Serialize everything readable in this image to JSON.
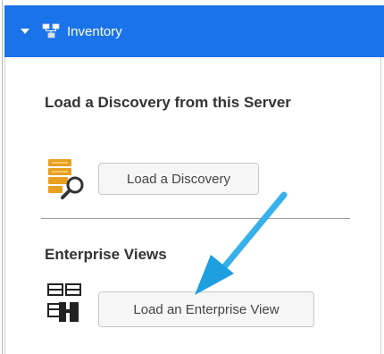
{
  "panel": {
    "title": "Inventory"
  },
  "discovery_section": {
    "title": "Load a Discovery from this Server",
    "button_label": "Load a Discovery"
  },
  "enterprise_section": {
    "title": "Enterprise Views",
    "button_label": "Load an Enterprise View"
  },
  "colors": {
    "header_bg": "#1a73e8",
    "arrow": "#29b6f6",
    "discovery_icon": "#e8a020"
  },
  "icons": {
    "header_toggle": "chevron-down-icon",
    "header_icon": "inventory-tree-icon",
    "discovery_icon": "database-search-icon",
    "enterprise_icon": "enterprise-view-icon"
  }
}
